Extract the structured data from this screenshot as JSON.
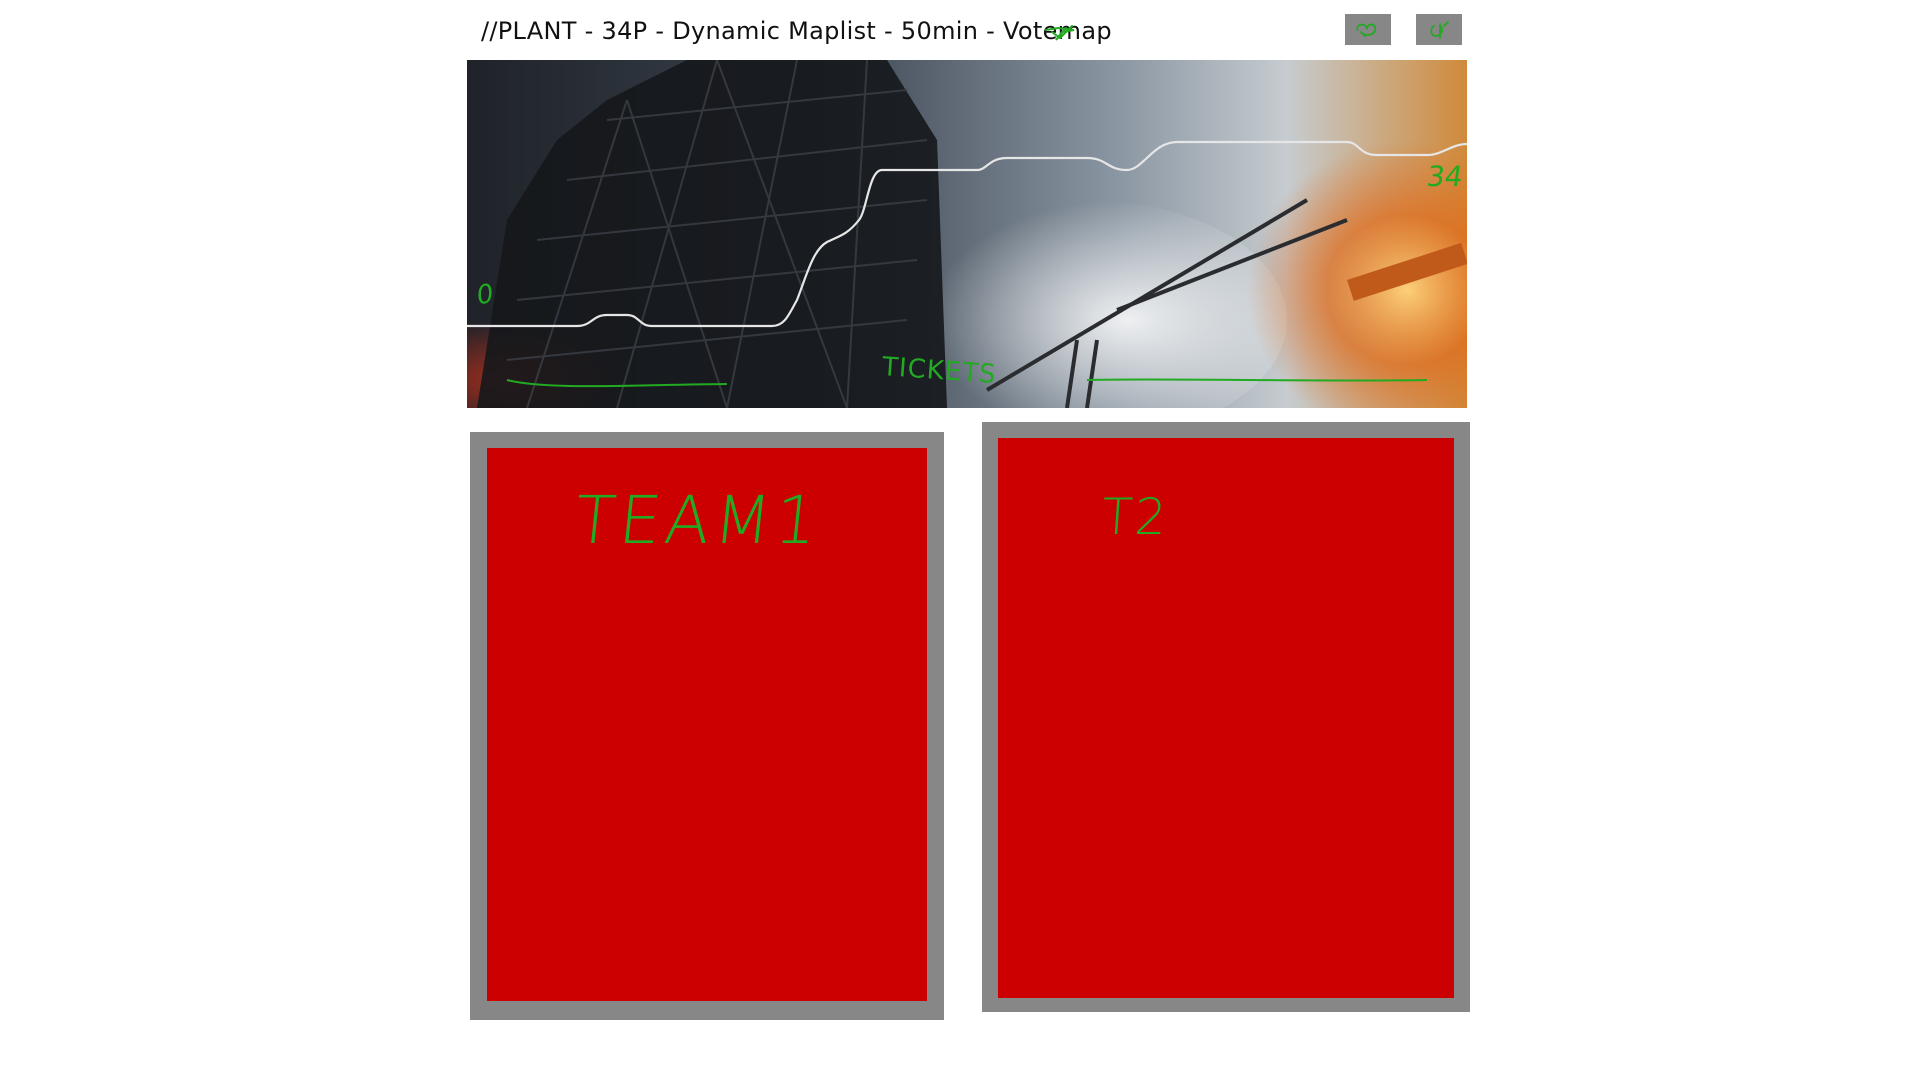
{
  "header": {
    "server_title": "//PLANT - 34P - Dynamic Maplist - 50min - Votemap",
    "buttons": [
      {
        "name": "left-header-button",
        "icon": "scribble-icon"
      },
      {
        "name": "right-header-button",
        "icon": "scribble-icon"
      }
    ]
  },
  "banner": {
    "label_left": "0",
    "label_right": "34",
    "label_center": "TICKETS"
  },
  "teams": [
    {
      "label": "TEAM1"
    },
    {
      "label": "T2"
    }
  ],
  "colors": {
    "team_fill": "#cc0000",
    "frame": "#878787",
    "annotation": "#22aa22",
    "graph_line": "#e6e6e6"
  }
}
